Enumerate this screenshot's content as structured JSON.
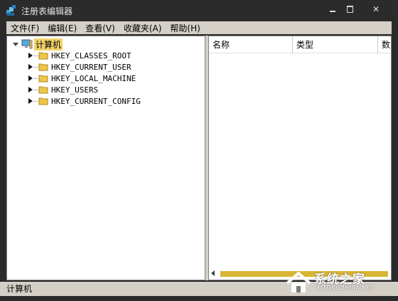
{
  "window": {
    "title": "注册表编辑器",
    "min_glyph": "",
    "max_glyph": "",
    "close_glyph": "✕"
  },
  "menu": [
    {
      "label": "文件(F)"
    },
    {
      "label": "编辑(E)"
    },
    {
      "label": "查看(V)"
    },
    {
      "label": "收藏夹(A)"
    },
    {
      "label": "帮助(H)"
    }
  ],
  "tree": {
    "root": "计算机",
    "keys": [
      "HKEY_CLASSES_ROOT",
      "HKEY_CURRENT_USER",
      "HKEY_LOCAL_MACHINE",
      "HKEY_USERS",
      "HKEY_CURRENT_CONFIG"
    ]
  },
  "list": {
    "columns": [
      "名称",
      "类型",
      "数"
    ]
  },
  "statusbar": {
    "path": "计算机"
  },
  "watermark": {
    "text": "系统之家",
    "url": "XITONGZHIJIA.NET"
  },
  "colors": {
    "chrome": "#2b2b2b",
    "menu_bg": "#d4d0c8",
    "selection": "#f3d36b",
    "scroll_thumb": "#d8b533"
  }
}
